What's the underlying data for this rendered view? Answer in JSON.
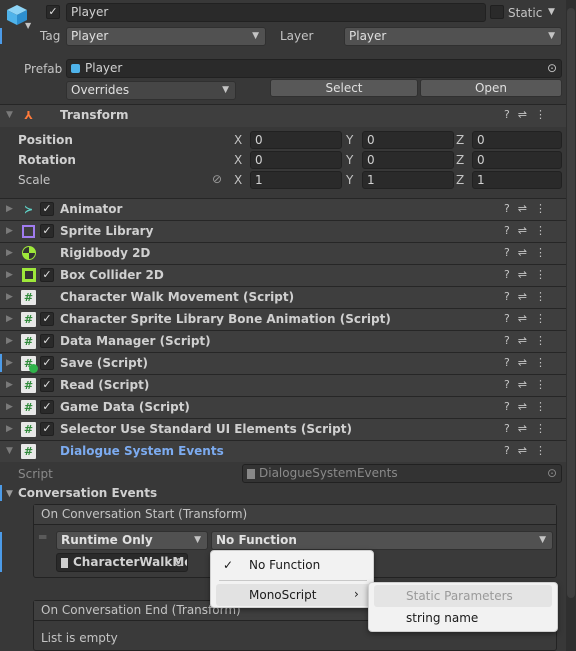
{
  "header": {
    "name": "Player",
    "active": true,
    "static_label": "Static",
    "static": false,
    "tag_label": "Tag",
    "tag": "Player",
    "layer_label": "Layer",
    "layer": "Player",
    "prefab_label": "Prefab",
    "prefab": "Player",
    "overrides": "Overrides",
    "select": "Select",
    "open": "Open"
  },
  "transform": {
    "title": "Transform",
    "rows": [
      {
        "label": "Position",
        "x": "0",
        "y": "0",
        "z": "0"
      },
      {
        "label": "Rotation",
        "x": "0",
        "y": "0",
        "z": "0"
      },
      {
        "label": "Scale",
        "x": "1",
        "y": "1",
        "z": "1"
      }
    ]
  },
  "components": [
    {
      "name": "Animator",
      "icon": "animator-icon",
      "checkbox": true
    },
    {
      "name": "Sprite Library",
      "icon": "sprite-library-icon",
      "checkbox": true
    },
    {
      "name": "Rigidbody 2D",
      "icon": "rigidbody-icon",
      "checkbox": false
    },
    {
      "name": "Box Collider 2D",
      "icon": "box-collider-icon",
      "checkbox": true
    },
    {
      "name": "Character Walk Movement (Script)",
      "icon": "script-icon",
      "checkbox": false
    },
    {
      "name": "Character Sprite Library Bone Animation (Script)",
      "icon": "script-icon",
      "checkbox": true
    },
    {
      "name": "Data Manager (Script)",
      "icon": "script-icon",
      "checkbox": true
    },
    {
      "name": "Save (Script)",
      "icon": "script-added-icon",
      "checkbox": true
    },
    {
      "name": "Read (Script)",
      "icon": "script-icon",
      "checkbox": true
    },
    {
      "name": "Game Data (Script)",
      "icon": "script-icon",
      "checkbox": true
    },
    {
      "name": "Selector Use Standard UI Elements (Script)",
      "icon": "script-icon",
      "checkbox": true
    }
  ],
  "dialogue": {
    "title": "Dialogue System Events",
    "script_label": "Script",
    "script": "DialogueSystemEvents",
    "section": "Conversation Events",
    "start_event": "On Conversation Start (Transform)",
    "runtime": "Runtime Only",
    "function": "No Function",
    "target": "CharacterWalkMov",
    "end_event": "On Conversation End (Transform)",
    "empty": "List is empty"
  },
  "menu": {
    "items": [
      "No Function",
      "MonoScript"
    ],
    "checked": "No Function",
    "submenu": [
      "Static Parameters",
      "string name"
    ]
  },
  "colors": {
    "accent": "#4c9be8",
    "title_link": "#7cabf0"
  }
}
